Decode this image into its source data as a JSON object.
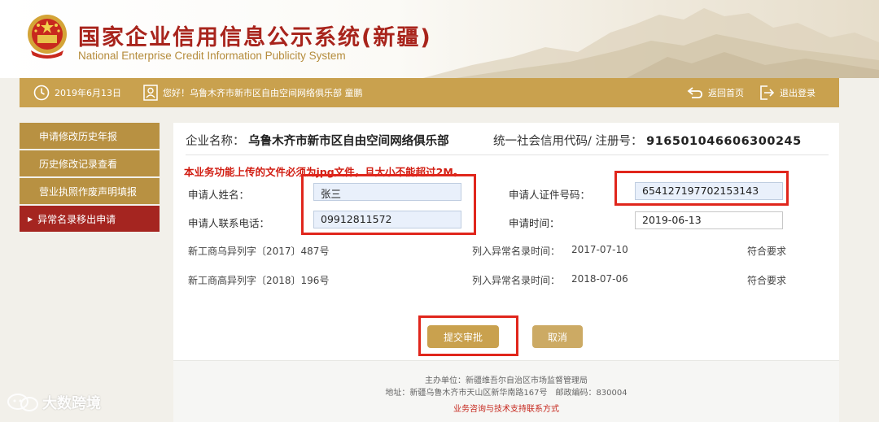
{
  "header": {
    "title": "国家企业信用信息公示系统(新疆)",
    "subtitle": "National Enterprise Credit Information Publicity System"
  },
  "topbar": {
    "date": "2019年6月13日",
    "greeting": "您好！乌鲁木齐市新市区自由空间网络俱乐部 童鹏",
    "home_label": "返回首页",
    "logout_label": "退出登录"
  },
  "sidebar": {
    "items": [
      {
        "label": "申请修改历史年报"
      },
      {
        "label": "历史修改记录查看"
      },
      {
        "label": "营业执照作废声明填报"
      },
      {
        "label": "异常名录移出申请"
      }
    ]
  },
  "form": {
    "company_label": "企业名称：",
    "company_name": "乌鲁木齐市新市区自由空间网络俱乐部",
    "credit_label": "统一社会信用代码/ 注册号：",
    "credit_code": "916501046606300245",
    "notice": "本业务功能上传的文件必须为jpg文件，且大小不能超过2M。",
    "applicant_name_label": "申请人姓名：",
    "applicant_name": "张三",
    "applicant_id_label": "申请人证件号码：",
    "applicant_id": "654127197702153143",
    "phone_label": "申请人联系电话：",
    "phone": "09912811572",
    "date_label": "申请时间：",
    "apply_date": "2019-06-13",
    "records": [
      {
        "doc": "新工商乌异列字〔2017〕487号",
        "time_label": "列入异常名录时间：",
        "time": "2017-07-10",
        "status": "符合要求"
      },
      {
        "doc": "新工商高异列字〔2018〕196号",
        "time_label": "列入异常名录时间：",
        "time": "2018-07-06",
        "status": "符合要求"
      }
    ],
    "submit_label": "提交审批",
    "cancel_label": "取消"
  },
  "footer": {
    "sponsor": "主办单位：新疆维吾尔自治区市场监督管理局",
    "address": "地址：新疆乌鲁木齐市天山区新华南路167号　邮政编码：830004",
    "contact_link": "业务咨询与技术支持联系方式"
  },
  "watermark": {
    "text": "大数跨境"
  },
  "colors": {
    "gold": "#c9a14e",
    "red": "#a52520",
    "alert": "#e0261c"
  }
}
